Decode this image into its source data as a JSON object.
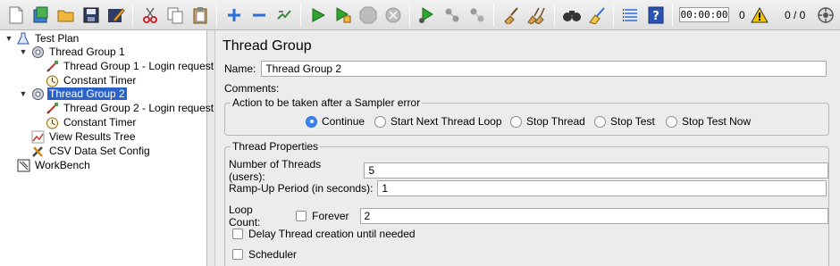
{
  "toolbar": {
    "timer": "00:00:00",
    "warnings_count": "0",
    "threads_ratio": "0 / 0",
    "icons": [
      "new-icon",
      "templates-icon",
      "open-icon",
      "save-icon",
      "save-as-icon",
      "cut-icon",
      "copy-icon",
      "paste-icon",
      "expand-icon",
      "collapse-icon",
      "toggle-icon",
      "start-icon",
      "start-no-pauses-icon",
      "stop-icon",
      "shutdown-icon",
      "remote-start-icon",
      "remote-stop-icon",
      "remote-shutdown-icon",
      "clear-icon",
      "clear-all-icon",
      "search-icon",
      "reset-search-icon",
      "function-helper-icon",
      "help-icon",
      "warning-icon",
      "status-indicator-icon"
    ]
  },
  "tree": {
    "items": [
      {
        "label": "Test Plan",
        "icon": "test-plan-icon"
      },
      {
        "label": "Thread Group 1",
        "icon": "thread-group-icon"
      },
      {
        "label": "Thread Group 1 - Login request",
        "icon": "sampler-icon"
      },
      {
        "label": "Constant Timer",
        "icon": "timer-icon"
      },
      {
        "label": "Thread Group 2",
        "icon": "thread-group-icon",
        "selected": true
      },
      {
        "label": "Thread Group 2 - Login request",
        "icon": "sampler-icon"
      },
      {
        "label": "Constant Timer",
        "icon": "timer-icon"
      },
      {
        "label": "View Results Tree",
        "icon": "listener-icon"
      },
      {
        "label": "CSV Data Set Config",
        "icon": "config-icon"
      },
      {
        "label": "WorkBench",
        "icon": "workbench-icon"
      }
    ]
  },
  "panel": {
    "title": "Thread Group",
    "name_label": "Name:",
    "name_value": "Thread Group 2",
    "comments_label": "Comments:",
    "sampler_error": {
      "legend": "Action to be taken after a Sampler error",
      "options": [
        "Continue",
        "Start Next Thread Loop",
        "Stop Thread",
        "Stop Test",
        "Stop Test Now"
      ],
      "selected": "Continue"
    },
    "thread_props": {
      "legend": "Thread Properties",
      "num_threads_label": "Number of Threads (users):",
      "num_threads_value": "5",
      "rampup_label": "Ramp-Up Period (in seconds):",
      "rampup_value": "1",
      "loop_label": "Loop Count:",
      "forever_label": "Forever",
      "loop_value": "2",
      "delay_label": "Delay Thread creation until needed",
      "scheduler_label": "Scheduler"
    }
  },
  "colors": {
    "selection": "#2a62c9",
    "radio_selected": "#3b83f0",
    "start_green": "#2fa52f"
  }
}
